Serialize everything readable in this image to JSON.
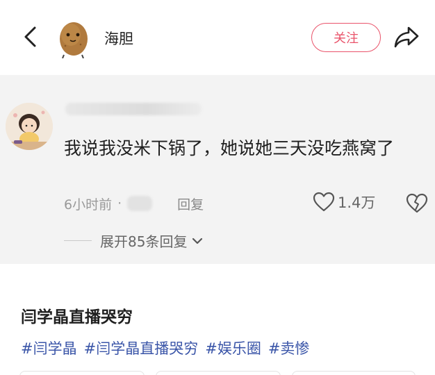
{
  "header": {
    "author_name": "海胆",
    "follow_label": "关注",
    "back_icon": "back-arrow-icon",
    "share_icon": "share-icon"
  },
  "comment": {
    "text": "我说我没米下锅了，她说她三天没吃燕窝了",
    "time": "6小时前",
    "separator": "·",
    "reply_label": "回复",
    "like_count": "1.4万",
    "expand_label": "展开85条回复"
  },
  "topic": {
    "title": "闫学晶直播哭穷",
    "tags": [
      "#闫学晶",
      "#闫学晶直播哭穷",
      "#娱乐圈",
      "#卖惨"
    ]
  },
  "colors": {
    "follow_accent": "#e9536a",
    "tag_blue": "#3a55a8",
    "comment_bg": "#f3f3f3"
  }
}
